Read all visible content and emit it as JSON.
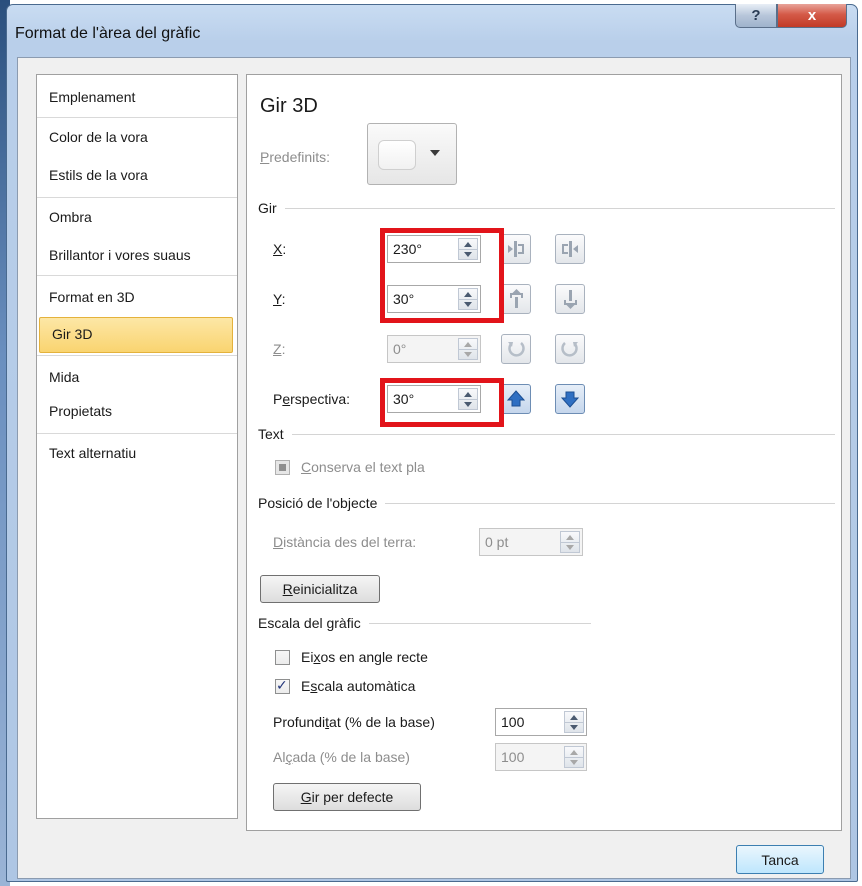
{
  "window": {
    "title": "Format de l'àrea del gràfic",
    "help_label": "?",
    "close_label": "x"
  },
  "sidebar": {
    "items": [
      {
        "label": "Emplenament"
      },
      {
        "label": "Color de la vora"
      },
      {
        "label": "Estils de la vora"
      },
      {
        "label": "Ombra"
      },
      {
        "label": "Brillantor i vores suaus"
      },
      {
        "label": "Format en 3D"
      },
      {
        "label": "Gir 3D",
        "selected": true
      },
      {
        "label": "Mida"
      },
      {
        "label": "Propietats"
      },
      {
        "label": "Text alternatiu"
      }
    ]
  },
  "panel": {
    "title": "Gir 3D",
    "presets": {
      "label_u": "P",
      "label_rest": "redefinits:"
    },
    "rotation": {
      "section": "Gir",
      "x": {
        "label_u": "X",
        "label_rest": ":",
        "value": "230°"
      },
      "y": {
        "label_u": "Y",
        "label_rest": ":",
        "value": "30°"
      },
      "z": {
        "label_u": "Z",
        "label_rest": ":",
        "value": "0°"
      },
      "perspective": {
        "label_pre": "P",
        "label_u": "e",
        "label_rest": "rspectiva:",
        "value": "30°"
      }
    },
    "text": {
      "section": "Text",
      "keep_flat_u": "C",
      "keep_flat_rest": "onserva el text pla"
    },
    "object_position": {
      "section": "Posició de l'objecte",
      "distance_u": "D",
      "distance_rest": "istància des del terra:",
      "distance_value": "0 pt"
    },
    "reset_u": "R",
    "reset_rest": "einicialitza",
    "chart_scale": {
      "section": "Escala del gràfic",
      "right_angle_pre": "Ei",
      "right_angle_u": "x",
      "right_angle_rest": "os en angle recte",
      "right_angle_checked": false,
      "autoscale_pre": "E",
      "autoscale_u": "s",
      "autoscale_rest": "cala automàtica",
      "autoscale_checked": true,
      "depth_pre": "Profundi",
      "depth_u": "t",
      "depth_rest": "at (% de la base)",
      "depth_value": "100",
      "height_pre": "Al",
      "height_u": "ç",
      "height_rest": "ada (% de la base)",
      "height_value": "100"
    },
    "default_rotation_u": "G",
    "default_rotation_rest": "ir per defecte"
  },
  "footer": {
    "close_label": "Tanca"
  },
  "colors": {
    "highlight": "#e2141a",
    "selection": "#f9d470"
  }
}
